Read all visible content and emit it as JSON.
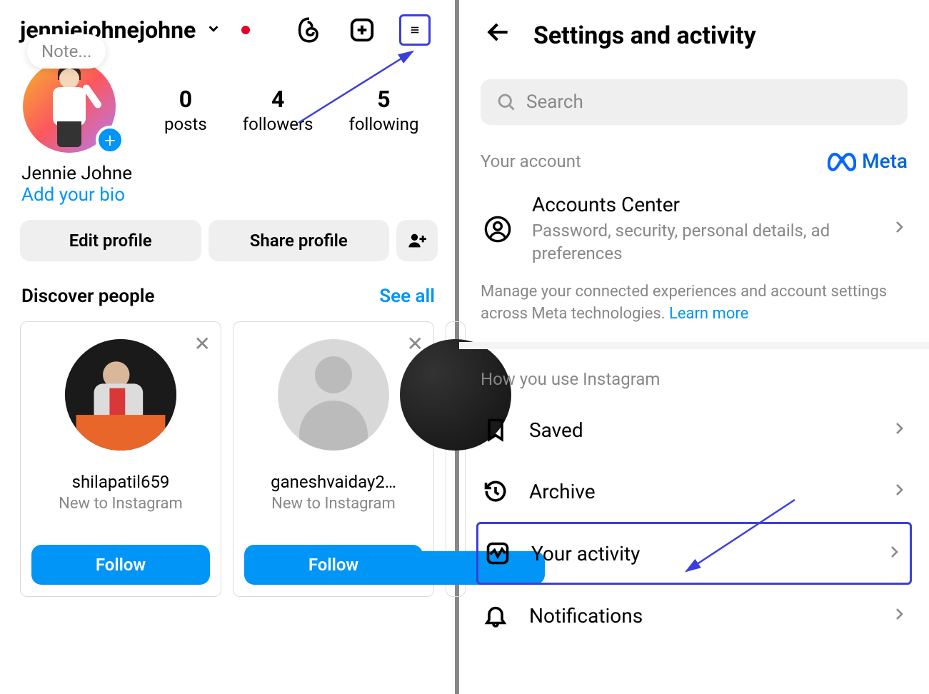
{
  "left": {
    "username": "jenniejohnejohne",
    "note_placeholder": "Note...",
    "stats": {
      "posts_count": "0",
      "posts_label": "posts",
      "followers_count": "4",
      "followers_label": "followers",
      "following_count": "5",
      "following_label": "following"
    },
    "display_name": "Jennie Johne",
    "add_bio": "Add your bio",
    "edit_profile": "Edit profile",
    "share_profile": "Share profile",
    "discover_title": "Discover people",
    "see_all": "See all",
    "people": [
      {
        "name": "shilapatil659",
        "sub": "New to Instagram",
        "follow": "Follow"
      },
      {
        "name": "ganeshvaiday2…",
        "sub": "New to Instagram",
        "follow": "Follow"
      }
    ]
  },
  "right": {
    "title": "Settings and activity",
    "search_placeholder": "Search",
    "account_label": "Your account",
    "meta_label": "Meta",
    "accounts_center": {
      "title": "Accounts Center",
      "sub": "Password, security, personal details, ad preferences"
    },
    "info_text": "Manage your connected experiences and account settings across Meta technologies. ",
    "learn_more": "Learn more",
    "usage_label": "How you use Instagram",
    "items": {
      "saved": "Saved",
      "archive": "Archive",
      "your_activity": "Your activity",
      "notifications": "Notifications"
    }
  }
}
